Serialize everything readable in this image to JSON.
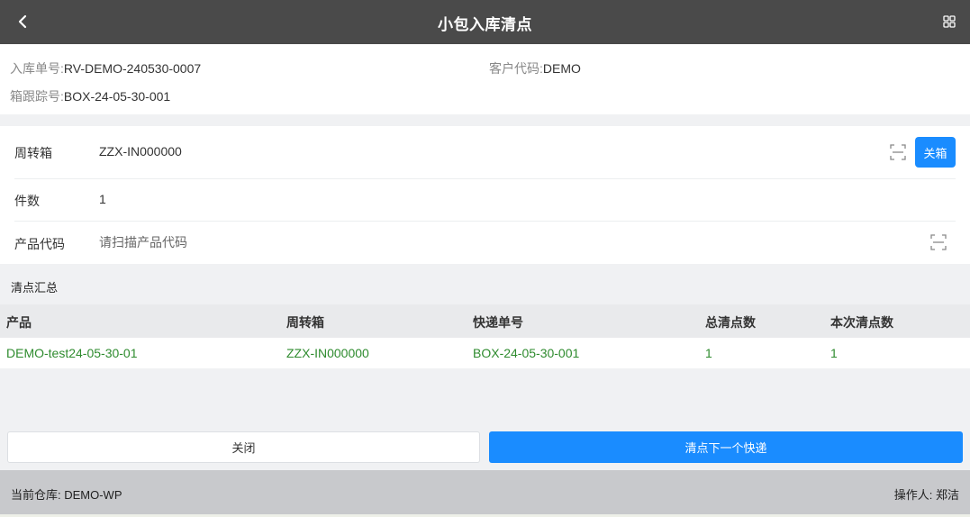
{
  "header": {
    "title": "小包入库清点"
  },
  "info": {
    "inbound_no_label": "入库单号:",
    "inbound_no_value": "RV-DEMO-240530-0007",
    "customer_code_label": "客户代码:",
    "customer_code_value": "DEMO",
    "box_tracking_label": "箱跟踪号:",
    "box_tracking_value": "BOX-24-05-30-001"
  },
  "form": {
    "tote_label": "周转箱",
    "tote_value": "ZZX-IN000000",
    "close_box_label": "关箱",
    "qty_label": "件数",
    "qty_value": "1",
    "product_label": "产品代码",
    "product_placeholder": "请扫描产品代码"
  },
  "summary": {
    "title": "清点汇总",
    "columns": [
      "产品",
      "周转箱",
      "快递单号",
      "总清点数",
      "本次清点数"
    ],
    "rows": [
      [
        "DEMO-test24-05-30-01",
        "ZZX-IN000000",
        "BOX-24-05-30-001",
        "1",
        "1"
      ]
    ]
  },
  "actions": {
    "close_label": "关闭",
    "next_label": "清点下一个快递"
  },
  "footer": {
    "warehouse_text": "当前仓库: DEMO-WP",
    "operator_text": "操作人: 郑洁"
  },
  "colors": {
    "header_bg": "#4a4a4a",
    "primary": "#1a8cff",
    "row_text": "#2e8b2e",
    "footer_bg": "#c8c9cc"
  },
  "icons": {
    "back": "chevron-left-icon",
    "apps": "grid-icon",
    "scan": "scan-icon"
  }
}
